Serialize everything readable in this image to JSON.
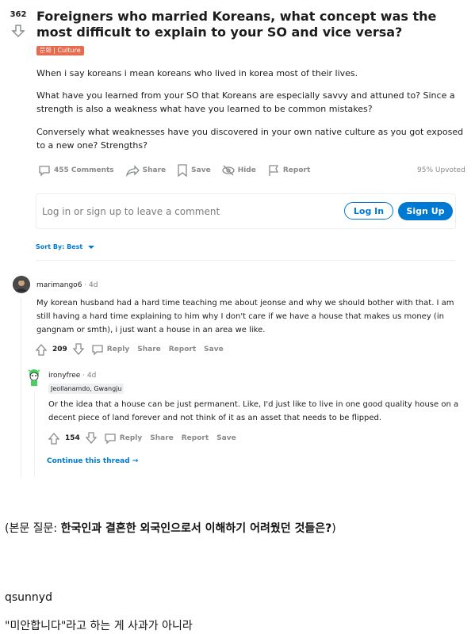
{
  "post": {
    "score": "362",
    "title": "Foreigners who married Koreans, what concept was the most difficult to explain to your SO and vice versa?",
    "flair": "문화 | Culture",
    "paragraphs": [
      "When i say koreans i mean koreans who lived in korea most of their lives.",
      "What have you learned from your SO that Koreans are especially savvy and attuned to? Since a strength is also a weakness what have you learned to be common mistakes?",
      "Conversely what weaknesses have you discovered in your own native culture as you got exposed to a new one? Strengths?"
    ],
    "actions": {
      "comments": "455 Comments",
      "share": "Share",
      "save": "Save",
      "hide": "Hide",
      "report": "Report"
    },
    "upvoted": "95% Upvoted"
  },
  "comment_box": {
    "prompt": "Log in or sign up to leave a comment",
    "login": "Log In",
    "signup": "Sign Up"
  },
  "sort": {
    "label": "Sort By: Best"
  },
  "comments": [
    {
      "user": "marimango6",
      "time": "· 4d",
      "text": "My korean husband had a hard time teaching me about jeonse and why we should bother with that. I am still having a hard time explaining to him why I don't care if we have a house that makes us money (in gangnam or smth), i just want a house in an area we like.",
      "score": "209",
      "reply": "Reply",
      "share": "Share",
      "report": "Report",
      "save": "Save"
    },
    {
      "user": "ironyfree",
      "time": "· 4d",
      "flair": "Jeollanamdo, Gwangju",
      "text": "Or the idea that a house can be just permanent. Like, I'd just like to live in one good quality house on a decent piece of land forever and not think of it as an asset that needs to be flipped.",
      "score": "154",
      "reply": "Reply",
      "share": "Share",
      "report": "Report",
      "save": "Save"
    }
  ],
  "continue_thread": "Continue this thread",
  "caption": {
    "prefix": "(본문 질문: ",
    "question": "한국인과 결혼한 외국인으로서 이해하기 어려웠던 것들은?",
    "suffix": ")"
  },
  "next_author": "qsunnyd",
  "next_quote": "\"미안합니다\"라고 하는 게 사과가 아니라"
}
